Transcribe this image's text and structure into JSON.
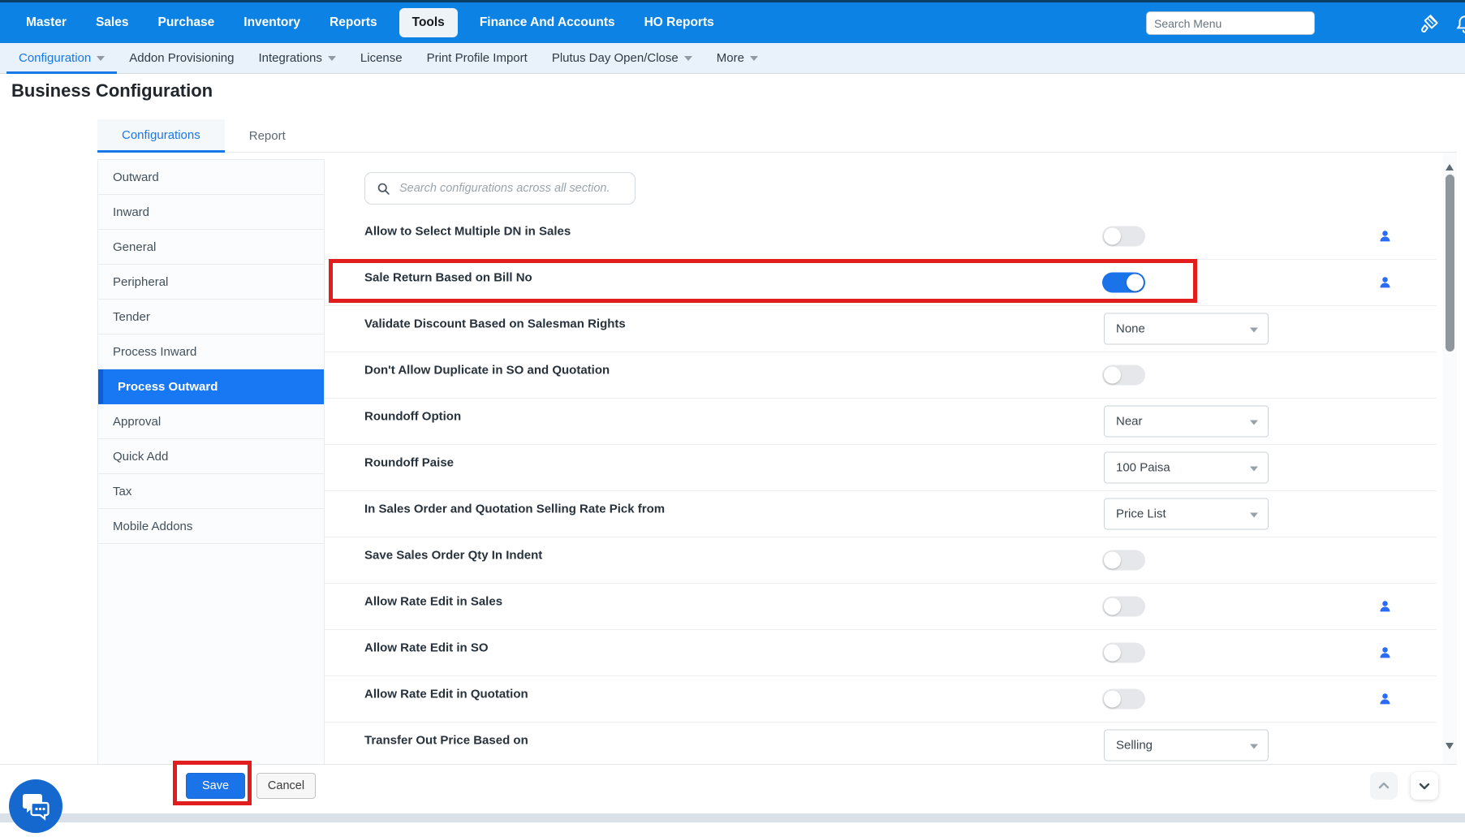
{
  "colors": {
    "topbar_blue": "#0c82e4",
    "accent_blue": "#1a73e8",
    "sidebar_active_blue": "#1877f2",
    "highlight_red": "#e11d1d",
    "chat_blue": "#1568cd"
  },
  "topnav": {
    "items": [
      {
        "label": "Master"
      },
      {
        "label": "Sales"
      },
      {
        "label": "Purchase"
      },
      {
        "label": "Inventory"
      },
      {
        "label": "Reports"
      },
      {
        "label": "Tools",
        "active": true
      },
      {
        "label": "Finance And Accounts"
      },
      {
        "label": "HO Reports"
      }
    ],
    "search_placeholder": "Search Menu",
    "icons": [
      "theme-brush-icon",
      "notifications-bell-icon"
    ]
  },
  "subnav": {
    "items": [
      {
        "label": "Configuration",
        "caret": true,
        "active": true
      },
      {
        "label": "Addon Provisioning"
      },
      {
        "label": "Integrations",
        "caret": true
      },
      {
        "label": "License"
      },
      {
        "label": "Print Profile Import"
      },
      {
        "label": "Plutus Day Open/Close",
        "caret": true
      },
      {
        "label": "More",
        "caret": true
      }
    ]
  },
  "page": {
    "title": "Business Configuration"
  },
  "tabs": [
    {
      "label": "Configurations",
      "active": true
    },
    {
      "label": "Report"
    }
  ],
  "sidebar": {
    "items": [
      {
        "label": "Outward"
      },
      {
        "label": "Inward"
      },
      {
        "label": "General"
      },
      {
        "label": "Peripheral"
      },
      {
        "label": "Tender"
      },
      {
        "label": "Process Inward"
      },
      {
        "label": "Process Outward",
        "active": true
      },
      {
        "label": "Approval"
      },
      {
        "label": "Quick Add"
      },
      {
        "label": "Tax"
      },
      {
        "label": "Mobile Addons"
      }
    ]
  },
  "content": {
    "search_placeholder": "Search configurations across all section."
  },
  "settings": [
    {
      "label": "Allow to Select Multiple DN in Sales",
      "control": "toggle",
      "value": false,
      "user_icon": true
    },
    {
      "label": "Sale Return Based on Bill No",
      "control": "toggle",
      "value": true,
      "user_icon": true,
      "highlighted": true
    },
    {
      "label": "Validate Discount Based on Salesman Rights",
      "control": "select",
      "value": "None"
    },
    {
      "label": "Don't Allow Duplicate in SO and Quotation",
      "control": "toggle",
      "value": false
    },
    {
      "label": "Roundoff Option",
      "control": "select",
      "value": "Near"
    },
    {
      "label": "Roundoff Paise",
      "control": "select",
      "value": "100 Paisa"
    },
    {
      "label": "In Sales Order and Quotation Selling Rate Pick from",
      "control": "select",
      "value": "Price List"
    },
    {
      "label": "Save Sales Order Qty In Indent",
      "control": "toggle",
      "value": false
    },
    {
      "label": "Allow Rate Edit in Sales",
      "control": "toggle",
      "value": false,
      "user_icon": true
    },
    {
      "label": "Allow Rate Edit in SO",
      "control": "toggle",
      "value": false,
      "user_icon": true
    },
    {
      "label": "Allow Rate Edit in Quotation",
      "control": "toggle",
      "value": false,
      "user_icon": true
    },
    {
      "label": "Transfer Out Price Based on",
      "control": "select",
      "value": "Selling"
    }
  ],
  "footer": {
    "save_label": "Save",
    "cancel_label": "Cancel"
  }
}
